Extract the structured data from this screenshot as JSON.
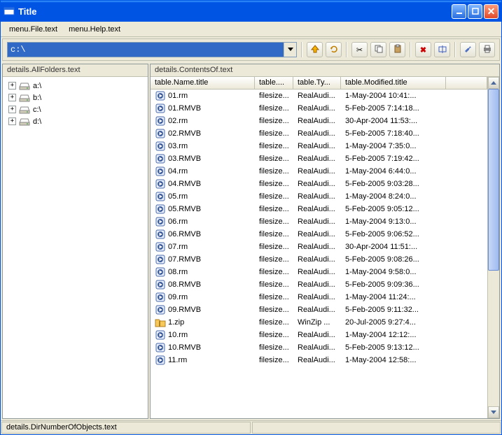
{
  "window": {
    "title": "Title"
  },
  "menu": {
    "file": "menu.File.text",
    "help": "menu.Help.text"
  },
  "toolbar": {
    "address": "c:\\"
  },
  "panels": {
    "folders_header": "details.AllFolders.text",
    "contents_header": "details.ContentsOf.text"
  },
  "tree": [
    {
      "label": "a:\\"
    },
    {
      "label": "b:\\"
    },
    {
      "label": "c:\\"
    },
    {
      "label": "d:\\"
    }
  ],
  "columns": {
    "name": "table.Name.title",
    "size": "table....",
    "type": "table.Ty...",
    "modified": "table.Modified.title"
  },
  "rows": [
    {
      "icon": "media",
      "name": "01.rm",
      "size": "filesize...",
      "type": "RealAudi...",
      "modified": "1-May-2004 10:41:..."
    },
    {
      "icon": "media",
      "name": "01.RMVB",
      "size": "filesize...",
      "type": "RealAudi...",
      "modified": "5-Feb-2005 7:14:18..."
    },
    {
      "icon": "media",
      "name": "02.rm",
      "size": "filesize...",
      "type": "RealAudi...",
      "modified": "30-Apr-2004 11:53:..."
    },
    {
      "icon": "media",
      "name": "02.RMVB",
      "size": "filesize...",
      "type": "RealAudi...",
      "modified": "5-Feb-2005 7:18:40..."
    },
    {
      "icon": "media",
      "name": "03.rm",
      "size": "filesize...",
      "type": "RealAudi...",
      "modified": "1-May-2004 7:35:0..."
    },
    {
      "icon": "media",
      "name": "03.RMVB",
      "size": "filesize...",
      "type": "RealAudi...",
      "modified": "5-Feb-2005 7:19:42..."
    },
    {
      "icon": "media",
      "name": "04.rm",
      "size": "filesize...",
      "type": "RealAudi...",
      "modified": "1-May-2004 6:44:0..."
    },
    {
      "icon": "media",
      "name": "04.RMVB",
      "size": "filesize...",
      "type": "RealAudi...",
      "modified": "5-Feb-2005 9:03:28..."
    },
    {
      "icon": "media",
      "name": "05.rm",
      "size": "filesize...",
      "type": "RealAudi...",
      "modified": "1-May-2004 8:24:0..."
    },
    {
      "icon": "media",
      "name": "05.RMVB",
      "size": "filesize...",
      "type": "RealAudi...",
      "modified": "5-Feb-2005 9:05:12..."
    },
    {
      "icon": "media",
      "name": "06.rm",
      "size": "filesize...",
      "type": "RealAudi...",
      "modified": "1-May-2004 9:13:0..."
    },
    {
      "icon": "media",
      "name": "06.RMVB",
      "size": "filesize...",
      "type": "RealAudi...",
      "modified": "5-Feb-2005 9:06:52..."
    },
    {
      "icon": "media",
      "name": "07.rm",
      "size": "filesize...",
      "type": "RealAudi...",
      "modified": "30-Apr-2004 11:51:..."
    },
    {
      "icon": "media",
      "name": "07.RMVB",
      "size": "filesize...",
      "type": "RealAudi...",
      "modified": "5-Feb-2005 9:08:26..."
    },
    {
      "icon": "media",
      "name": "08.rm",
      "size": "filesize...",
      "type": "RealAudi...",
      "modified": "1-May-2004 9:58:0..."
    },
    {
      "icon": "media",
      "name": "08.RMVB",
      "size": "filesize...",
      "type": "RealAudi...",
      "modified": "5-Feb-2005 9:09:36..."
    },
    {
      "icon": "media",
      "name": "09.rm",
      "size": "filesize...",
      "type": "RealAudi...",
      "modified": "1-May-2004 11:24:..."
    },
    {
      "icon": "media",
      "name": "09.RMVB",
      "size": "filesize...",
      "type": "RealAudi...",
      "modified": "5-Feb-2005 9:11:32..."
    },
    {
      "icon": "zip",
      "name": "1.zip",
      "size": "filesize...",
      "type": "WinZip ...",
      "modified": "20-Jul-2005 9:27:4..."
    },
    {
      "icon": "media",
      "name": "10.rm",
      "size": "filesize...",
      "type": "RealAudi...",
      "modified": "1-May-2004 12:12:..."
    },
    {
      "icon": "media",
      "name": "10.RMVB",
      "size": "filesize...",
      "type": "RealAudi...",
      "modified": "5-Feb-2005 9:13:12..."
    },
    {
      "icon": "media",
      "name": "11.rm",
      "size": "filesize...",
      "type": "RealAudi...",
      "modified": "1-May-2004 12:58:..."
    }
  ],
  "statusbar": {
    "left": "details.DirNumberOfObjects.text",
    "right": ""
  }
}
